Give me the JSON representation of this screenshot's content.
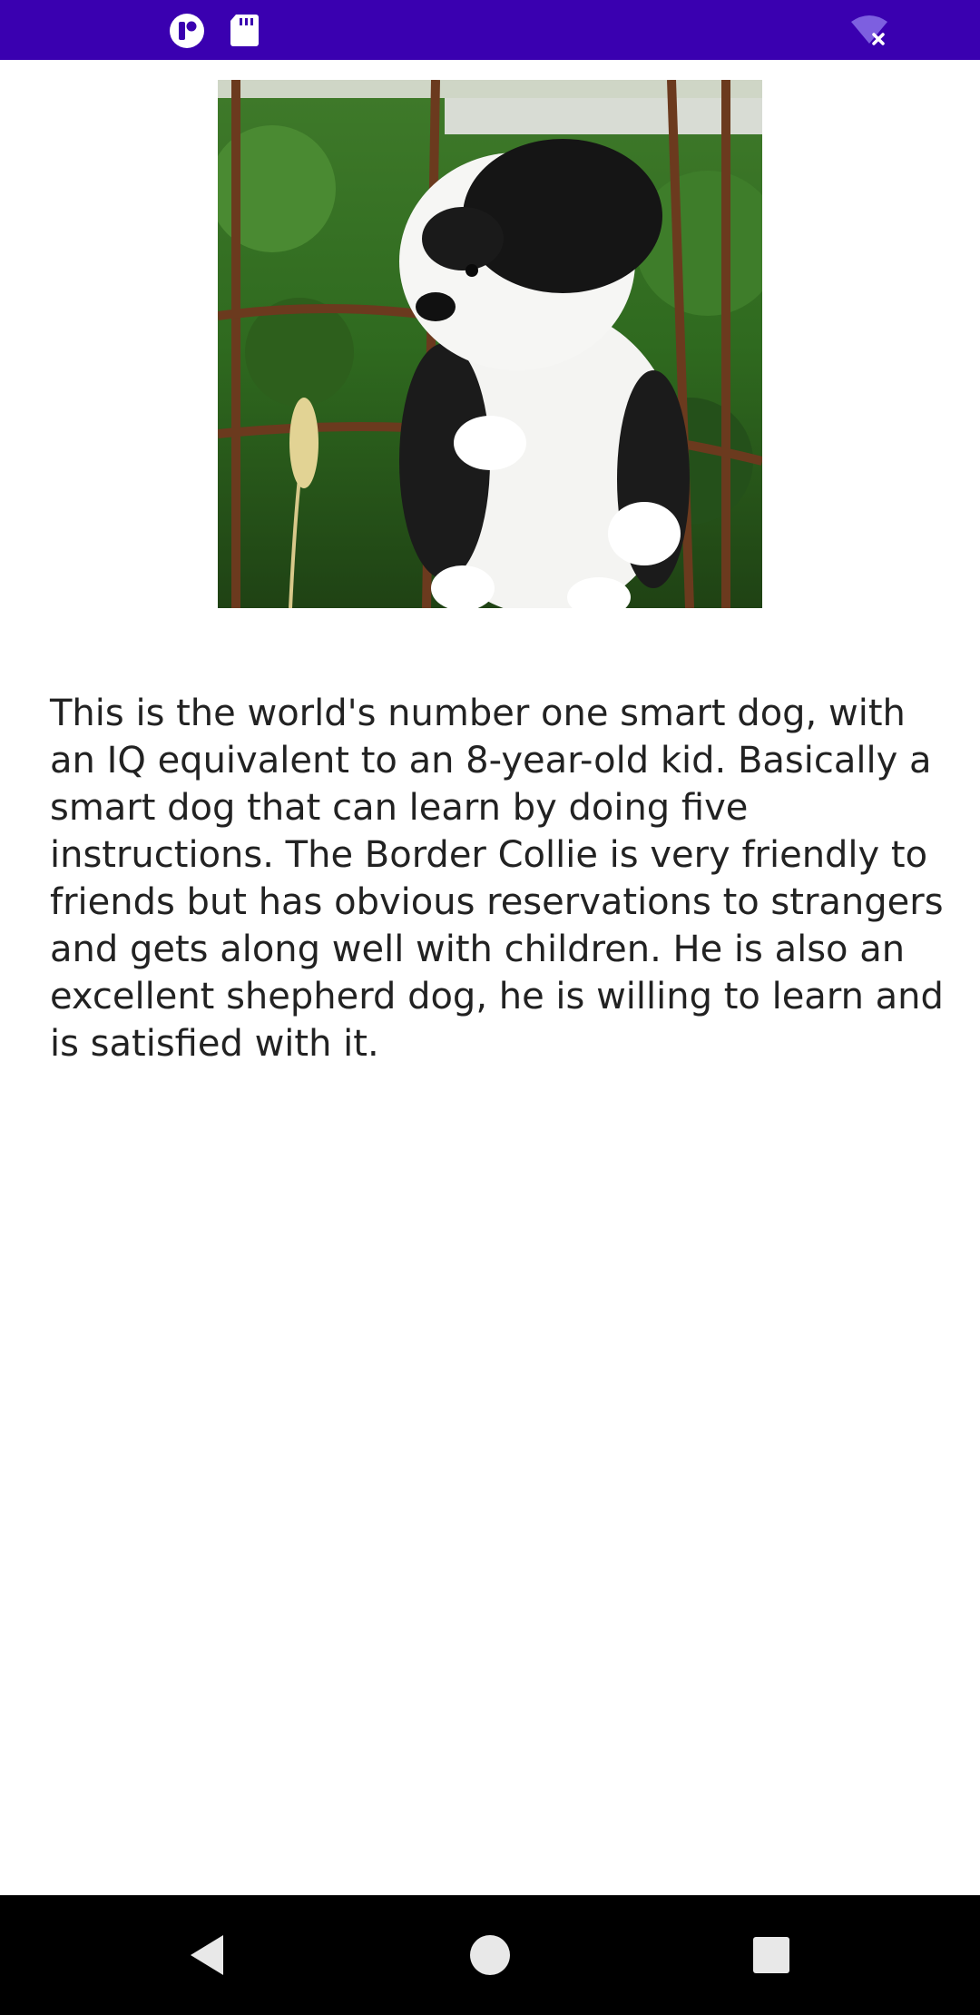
{
  "status_bar": {
    "bg_color": "#3A00B0",
    "icons": [
      "notification-app-icon",
      "sd-card-icon",
      "wifi-off-icon"
    ]
  },
  "content": {
    "image_subject": "dog-photo",
    "description": "This is the world's number one smart dog, with an IQ equivalent to an 8-year-old kid. Basically a smart dog that can learn by doing five instructions. The Border Collie is very friendly to friends but has obvious reservations to strangers and gets along well with children. He is also an excellent shepherd dog, he is willing to learn and is satisfied with it."
  },
  "nav_bar": {
    "bg_color": "#000000",
    "buttons": [
      "back-icon",
      "home-icon",
      "recents-icon"
    ]
  }
}
